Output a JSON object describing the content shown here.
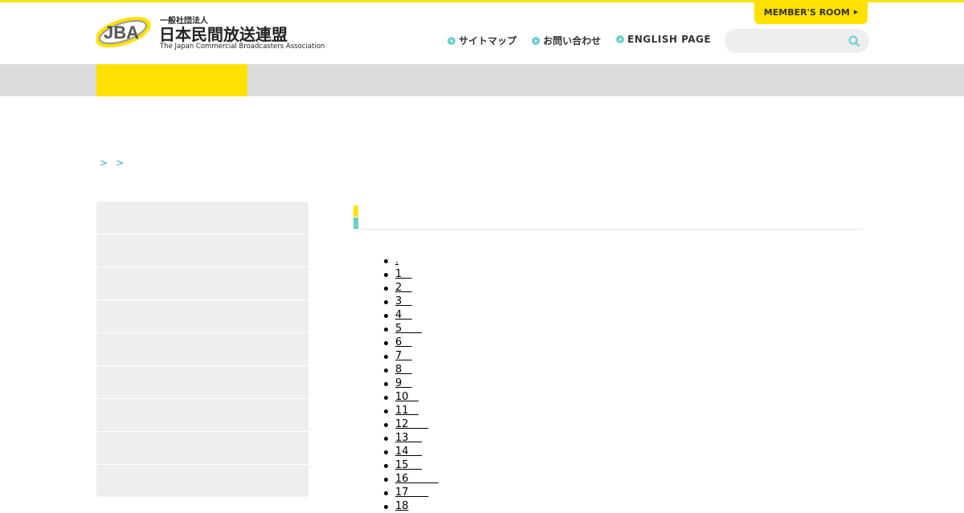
{
  "header": {
    "logo": {
      "mark": "JBA",
      "small_text": "一般社団法人",
      "big_text": "日本民間放送連盟",
      "english_text": "The Japan Commercial Broadcasters Association"
    },
    "member_button": "MEMBER'S ROOM",
    "nav": [
      {
        "label": "サイトマップ"
      },
      {
        "label": "お問い合わせ"
      },
      {
        "label": "ENGLISH PAGE"
      }
    ],
    "search": {
      "placeholder": ""
    }
  },
  "breadcrumb": [
    ">",
    ">"
  ],
  "sidebar": {
    "items": [
      "",
      "",
      "",
      "",
      "",
      "",
      "",
      "",
      ""
    ]
  },
  "list": {
    "items": [
      ".",
      "1   ",
      "2   ",
      "3   ",
      "4   ",
      "5      ",
      "6   ",
      "7   ",
      "8   ",
      "9   ",
      "10   ",
      "11   ",
      "12      ",
      "13    ",
      "14    ",
      "15    ",
      "16         ",
      "17      ",
      "18"
    ]
  },
  "colors": {
    "brand_yellow": "#ffe100",
    "accent_cyan": "#6ccfcf",
    "link_teal": "#3aa7b8"
  },
  "icons": [
    "search-icon",
    "arrow-right-icon",
    "circle-arrow-icon"
  ]
}
